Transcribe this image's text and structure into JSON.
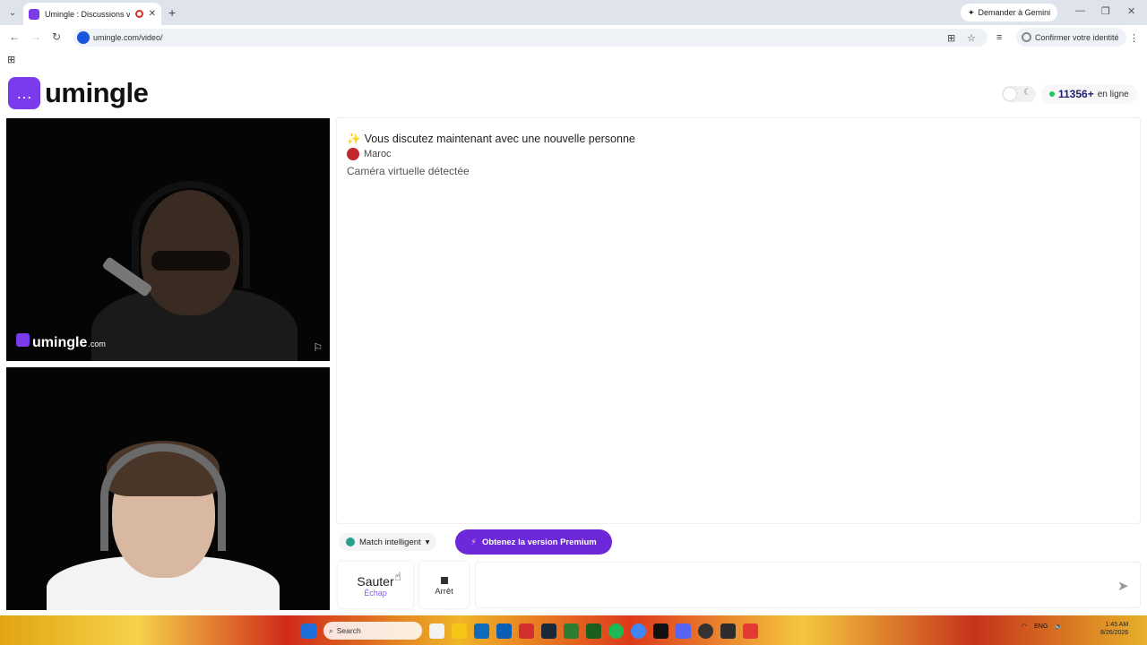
{
  "browser": {
    "tab_title": "Umingle : Discussions vidé",
    "new_tab_symbol": "+",
    "gemini_label": "Demander à Gemini",
    "url": "umingle.com/video/",
    "identity_label": "Confirmer votre identité"
  },
  "header": {
    "logo_text": "umingle",
    "online_count": "11356+",
    "online_label": "en ligne"
  },
  "video": {
    "watermark_brand": "umingle",
    "watermark_domain": ".com"
  },
  "chat": {
    "new_person": "Vous discutez maintenant avec une nouvelle personne",
    "country": "Maroc",
    "virtual_camera": "Caméra virtuelle détectée"
  },
  "controls": {
    "match_label": "Match intelligent",
    "premium_label": "Obtenez la version Premium",
    "skip_label": "Sauter",
    "skip_shortcut": "Échap",
    "stop_label": "Arrêt"
  },
  "taskbar": {
    "search_placeholder": "Search",
    "language": "ENG",
    "time": "1:45 AM",
    "date": "8/26/2026"
  },
  "colors": {
    "brand": "#7c3aed",
    "premium": "#6d28d9",
    "online_dot": "#22c55e",
    "country_flag": "#c1272d"
  }
}
